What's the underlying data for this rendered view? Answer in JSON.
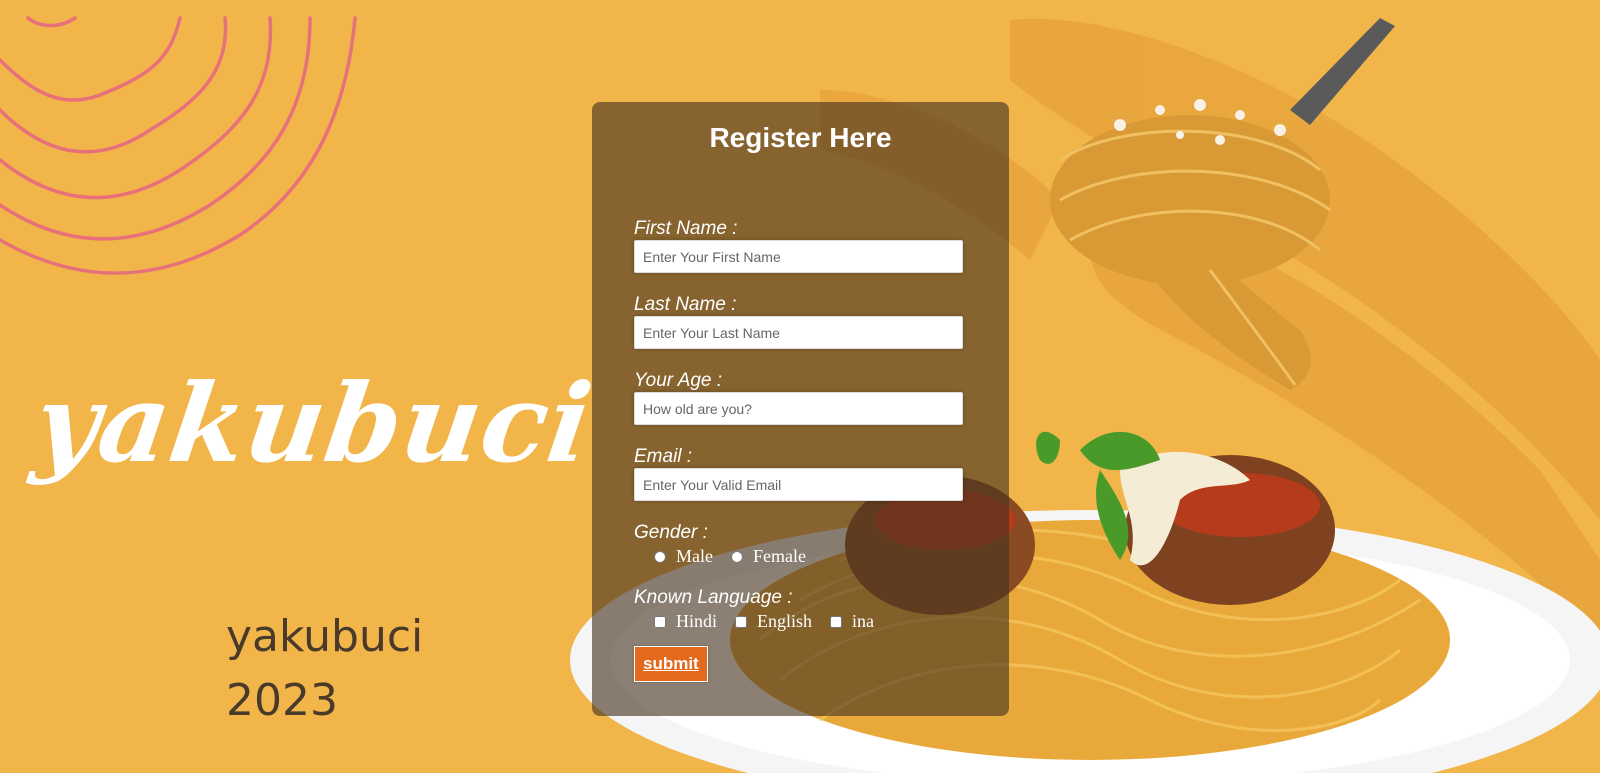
{
  "brand": {
    "script_logo": "yakubuci",
    "footer_name": "yakubuci",
    "footer_year": "2023"
  },
  "form": {
    "title": "Register Here",
    "first_name": {
      "label": "First Name :",
      "placeholder": "Enter Your First Name"
    },
    "last_name": {
      "label": "Last Name :",
      "placeholder": "Enter Your Last Name"
    },
    "age": {
      "label": "Your Age :",
      "placeholder": "How old are you?"
    },
    "email": {
      "label": "Email :",
      "placeholder": "Enter Your Valid Email"
    },
    "gender": {
      "label": "Gender :",
      "options": [
        "Male",
        "Female"
      ]
    },
    "languages": {
      "label": "Known Language :",
      "options": [
        "Hindi",
        "English",
        "ina"
      ]
    },
    "submit_label": "submit"
  },
  "colors": {
    "background": "#f1b54a",
    "card": "rgba(70,50,30,0.62)",
    "accent_squiggle": "#e8707a",
    "submit": "#e36a1c"
  },
  "icons": [
    "squiggle-lines-decoration",
    "spaghetti-fork-image",
    "spaghetti-plate-image"
  ]
}
